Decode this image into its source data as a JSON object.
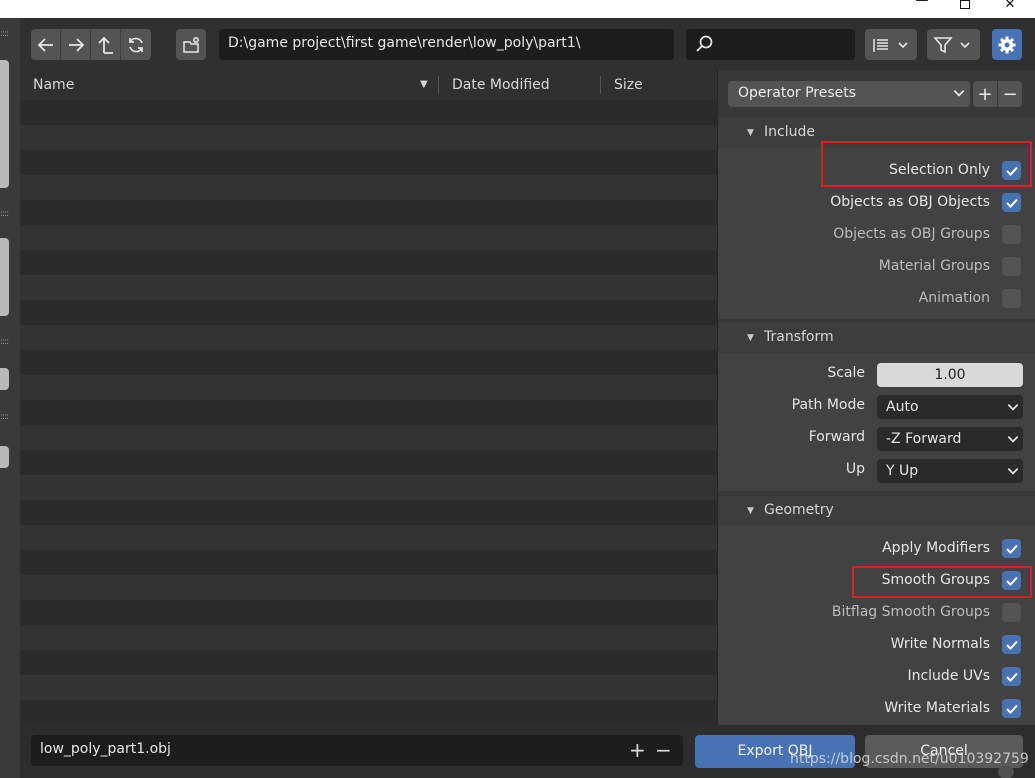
{
  "window": {
    "minimize_label": "—",
    "close_label": "✕"
  },
  "toolbar": {
    "path": "D:\\game project\\first game\\render\\low_poly\\part1\\",
    "search_placeholder": ""
  },
  "filelist": {
    "col_name": "Name",
    "col_date": "Date Modified",
    "col_size": "Size",
    "sort_indicator": "▼"
  },
  "sidebar": {
    "presets_label": "Operator Presets",
    "add_label": "+",
    "remove_label": "−",
    "include": {
      "title": "Include",
      "items": [
        {
          "label": "Selection Only",
          "checked": true
        },
        {
          "label": "Objects as OBJ Objects",
          "checked": true
        },
        {
          "label": "Objects as OBJ Groups",
          "checked": false
        },
        {
          "label": "Material Groups",
          "checked": false
        },
        {
          "label": "Animation",
          "checked": false
        }
      ]
    },
    "transform": {
      "title": "Transform",
      "scale_label": "Scale",
      "scale_value": "1.00",
      "path_mode_label": "Path Mode",
      "path_mode_value": "Auto",
      "forward_label": "Forward",
      "forward_value": "-Z Forward",
      "up_label": "Up",
      "up_value": "Y Up"
    },
    "geometry": {
      "title": "Geometry",
      "items": [
        {
          "label": "Apply Modifiers",
          "checked": true
        },
        {
          "label": "Smooth Groups",
          "checked": true
        },
        {
          "label": "Bitflag Smooth Groups",
          "checked": false
        },
        {
          "label": "Write Normals",
          "checked": true
        },
        {
          "label": "Include UVs",
          "checked": true
        },
        {
          "label": "Write Materials",
          "checked": true
        }
      ]
    }
  },
  "bottom": {
    "filename": "low_poly_part1.obj",
    "increment_label": "+",
    "decrement_label": "−",
    "export_label": "Export OBJ",
    "cancel_label": "Cancel",
    "watermark": "https://blog.csdn.net/u010392759"
  },
  "colors": {
    "accent": "#4772b3",
    "highlight_box": "#e02020"
  }
}
